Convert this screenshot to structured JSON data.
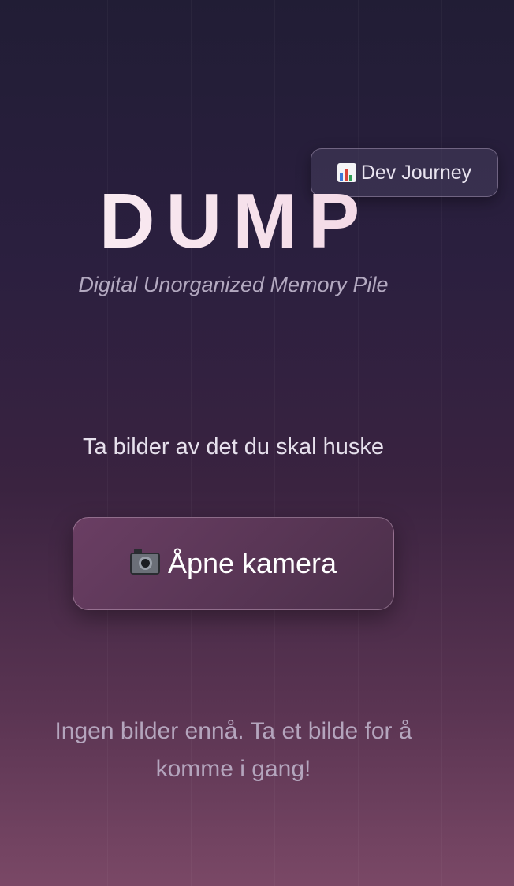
{
  "header": {
    "dev_journey_label": "Dev Journey",
    "dev_journey_icon": "bar-chart-icon",
    "title": "DUMP",
    "subtitle": "Digital Unorganized Memory Pile"
  },
  "main": {
    "instruction": "Ta bilder av det du skal huske",
    "camera_button_label": "Åpne kamera",
    "camera_button_icon": "camera-icon",
    "empty_message": "Ingen bilder ennå. Ta et bilde for å komme i gang!"
  },
  "colors": {
    "background_top": "#211d35",
    "background_bottom": "#7a4866",
    "button": "#6a3e63",
    "title": "#f4dde8"
  }
}
